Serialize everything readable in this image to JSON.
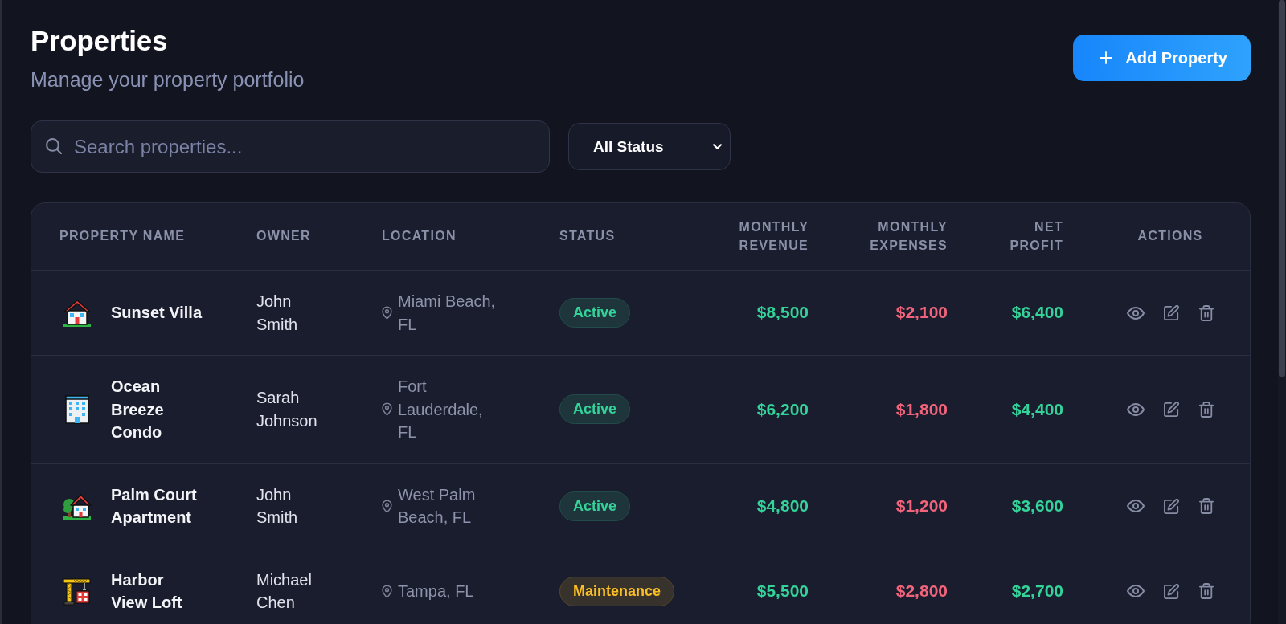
{
  "page": {
    "title": "Properties",
    "subtitle": "Manage your property portfolio"
  },
  "add_button": {
    "label": "Add Property"
  },
  "search": {
    "placeholder": "Search properties..."
  },
  "status_filter": {
    "value": "All Status"
  },
  "table": {
    "columns": [
      "PROPERTY NAME",
      "OWNER",
      "LOCATION",
      "STATUS",
      "MONTHLY REVENUE",
      "MONTHLY EXPENSES",
      "NET PROFIT",
      "ACTIONS"
    ],
    "rows": [
      {
        "kind": "house",
        "name": "Sunset Villa",
        "owner": "John Smith",
        "location": "Miami Beach, FL",
        "status": {
          "label": "Active",
          "color": "#34d399"
        },
        "monthly_revenue": "$8,500",
        "monthly_expenses": "$2,100",
        "net_profit": "$6,400"
      },
      {
        "kind": "building",
        "name": "Ocean Breeze Condo",
        "owner": "Sarah Johnson",
        "location": "Fort Lauderdale, FL",
        "status": {
          "label": "Active",
          "color": "#34d399"
        },
        "monthly_revenue": "$6,200",
        "monthly_expenses": "$1,800",
        "net_profit": "$4,400"
      },
      {
        "kind": "cottage",
        "name": "Palm Court Apartment",
        "owner": "John Smith",
        "location": "West Palm Beach, FL",
        "status": {
          "label": "Active",
          "color": "#34d399"
        },
        "monthly_revenue": "$4,800",
        "monthly_expenses": "$1,200",
        "net_profit": "$3,600"
      },
      {
        "kind": "construction",
        "name": "Harbor View Loft",
        "owner": "Michael Chen",
        "location": "Tampa, FL",
        "status": {
          "label": "Maintenance",
          "color": "#fbbf24"
        },
        "monthly_revenue": "$5,500",
        "monthly_expenses": "$2,800",
        "net_profit": "$2,700"
      }
    ]
  }
}
